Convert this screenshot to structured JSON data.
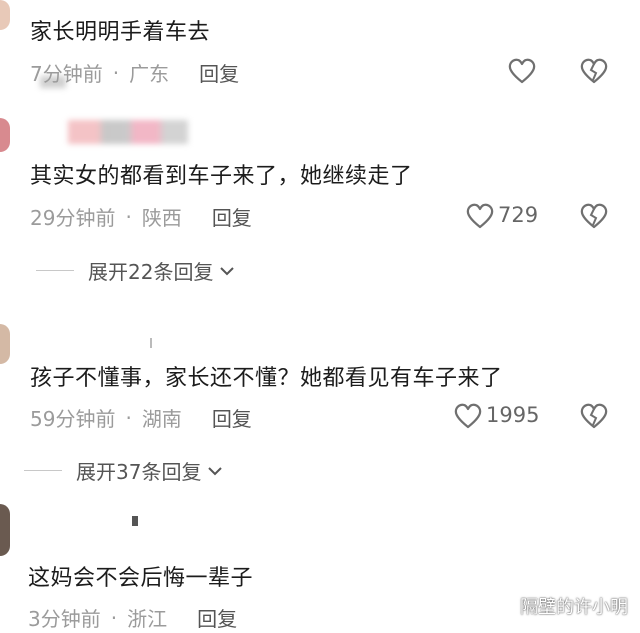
{
  "comments": [
    {
      "text": "家长明明手着车去",
      "time": "7分钟前",
      "location": "广东",
      "reply_label": "回复",
      "likes": ""
    },
    {
      "text": "其实女的都看到车子来了，她继续走了",
      "time": "29分钟前",
      "location": "陕西",
      "reply_label": "回复",
      "likes": "729",
      "expand_label": "展开22条回复"
    },
    {
      "text": "孩子不懂事，家长还不懂？她都看见有车子来了",
      "time": "59分钟前",
      "location": "湖南",
      "reply_label": "回复",
      "likes": "1995",
      "expand_label": "展开37条回复"
    },
    {
      "text": "这妈会不会后悔一辈子",
      "time": "3分钟前",
      "location": "浙江",
      "reply_label": "回复",
      "likes": ""
    }
  ],
  "separator": "·",
  "watermark": {
    "text": "隔壁的许小明",
    "icon": "chat-bubble-icon"
  },
  "icons": {
    "like": "heart-outline-icon",
    "dislike": "broken-heart-icon",
    "expand": "chevron-down-icon"
  },
  "colors": {
    "text": "#1c1c1c",
    "meta": "#9b9b9b",
    "reply": "#555555",
    "icon": "#707070"
  }
}
